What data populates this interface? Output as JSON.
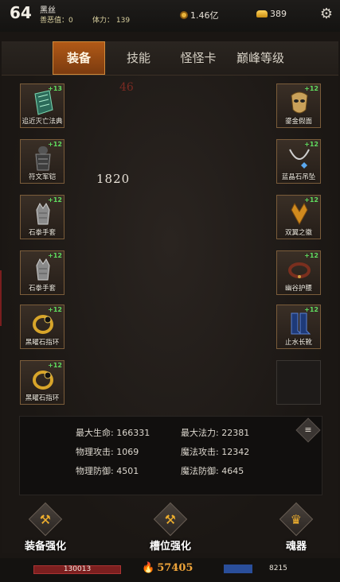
{
  "header": {
    "level": "64",
    "player_name": "黑丝",
    "evil_value": "善恶值：0",
    "stamina": "体力： 139",
    "coins": "1.46亿",
    "gold": "389",
    "icons": {
      "coin": "coin-icon",
      "gold": "gold-ingot-icon",
      "settings": "gear-icon"
    }
  },
  "tabs": [
    "装备",
    "技能",
    "怪怪卡",
    "巅峰等级"
  ],
  "active_tab": "装备",
  "floating_numbers": {
    "a": "46",
    "b": "1820"
  },
  "left_slots": [
    {
      "name": "追近灭亡法典",
      "plus": "+13"
    },
    {
      "name": "符文军铠",
      "plus": "+12"
    },
    {
      "name": "石拳手套",
      "plus": "+12"
    },
    {
      "name": "石拳手套",
      "plus": "+12"
    },
    {
      "name": "黑曜石指环",
      "plus": "+12"
    },
    {
      "name": "黑曜石指环",
      "plus": "+12"
    }
  ],
  "right_slots": [
    {
      "name": "鎏金假面",
      "plus": "+12"
    },
    {
      "name": "蓝晶石吊坠",
      "plus": "+12"
    },
    {
      "name": "双翼之徽",
      "plus": "+12"
    },
    {
      "name": "幽谷护腰",
      "plus": "+12"
    },
    {
      "name": "止水长靴",
      "plus": "+12"
    },
    {
      "name": "",
      "plus": ""
    }
  ],
  "stats": {
    "max_hp": "最大生命: 166331",
    "max_mp": "最大法力: 22381",
    "phys_atk": "物理攻击: 1069",
    "magic_atk": "魔法攻击: 12342",
    "phys_def": "物理防御: 4501",
    "magic_def": "魔法防御: 4645",
    "menu_icon": "menu-icon"
  },
  "actions": [
    "装备强化",
    "槽位强化",
    "魂器"
  ],
  "bottom": {
    "hp": "130013",
    "combat_power": "57405",
    "mp": "8215"
  }
}
